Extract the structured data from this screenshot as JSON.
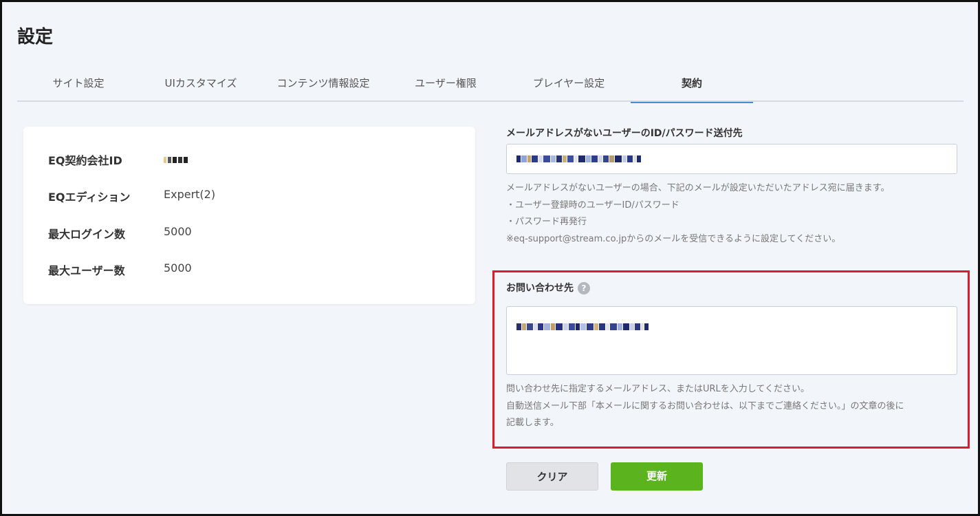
{
  "page": {
    "title": "設定"
  },
  "tabs": [
    {
      "label": "サイト設定"
    },
    {
      "label": "UIカスタマイズ"
    },
    {
      "label": "コンテンツ情報設定"
    },
    {
      "label": "ユーザー権限"
    },
    {
      "label": "プレイヤー設定"
    },
    {
      "label": "契約",
      "active": true
    }
  ],
  "contract_info": {
    "rows": [
      {
        "label": "EQ契約会社ID",
        "value": ""
      },
      {
        "label": "EQエディション",
        "value": "Expert(2)"
      },
      {
        "label": "最大ログイン数",
        "value": "5000"
      },
      {
        "label": "最大ユーザー数",
        "value": "5000"
      }
    ]
  },
  "id_password_destination": {
    "label": "メールアドレスがないユーザーのID/パスワード送付先",
    "help_lines": [
      "メールアドレスがないユーザーの場合、下記のメールが設定いただいたアドレス宛に届きます。",
      "・ユーザー登録時のユーザーID/パスワード",
      "・パスワード再発行",
      "※eq-support@stream.co.jpからのメールを受信できるように設定してください。"
    ]
  },
  "contact": {
    "label": "お問い合わせ先",
    "help_icon": "question-circle-icon",
    "help_lines": [
      "問い合わせ先に指定するメールアドレス、またはURLを入力してください。",
      "自動送信メール下部「本メールに関するお問い合わせは、以下までご連絡ください。」の文章の後に",
      "記載します。"
    ]
  },
  "buttons": {
    "clear": "クリア",
    "update": "更新"
  },
  "colors": {
    "active_tab": "#4a8bd6",
    "update_button": "#5bb31d",
    "highlight_border": "#e11a2b"
  }
}
